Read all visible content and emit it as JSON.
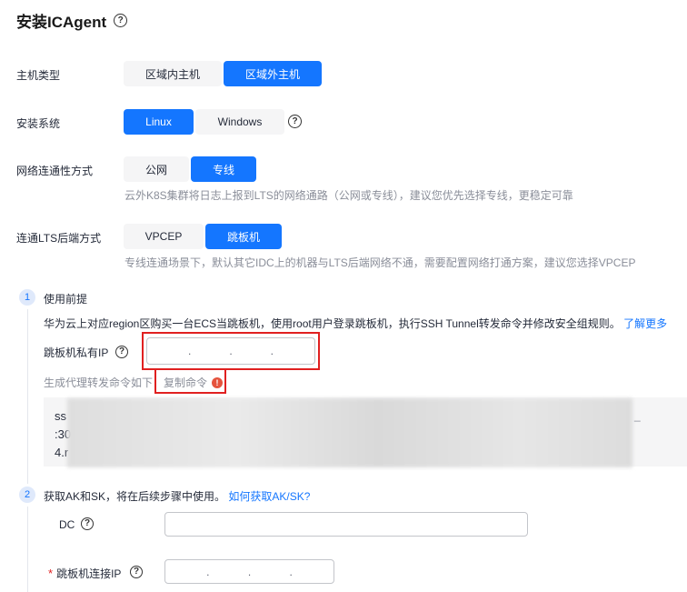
{
  "title": "安装ICAgent",
  "rows": {
    "host_type": {
      "label": "主机类型",
      "options": [
        "区域内主机",
        "区域外主机"
      ],
      "selected": 1
    },
    "os": {
      "label": "安装系统",
      "options": [
        "Linux",
        "Windows"
      ],
      "selected": 0
    },
    "network": {
      "label": "网络连通性方式",
      "options": [
        "公网",
        "专线"
      ],
      "selected": 1,
      "hint": "云外K8S集群将日志上报到LTS的网络通路（公网或专线），建议您优先选择专线，更稳定可靠"
    },
    "lts_backend": {
      "label": "连通LTS后端方式",
      "options": [
        "VPCEP",
        "跳板机"
      ],
      "selected": 1,
      "hint": "专线连通场景下，默认其它IDC上的机器与LTS后端网络不通，需要配置网络打通方案，建议您选择VPCEP"
    }
  },
  "step1": {
    "num": "1",
    "title": "使用前提",
    "desc": "华为云上对应region区购买一台ECS当跳板机，使用root用户登录跳板机，执行SSH Tunnel转发命令并修改安全组规则。",
    "learn_more": "了解更多",
    "ip_label": "跳板机私有IP",
    "ip_dots": [
      ".",
      ".",
      "."
    ],
    "gen_label": "生成代理转发命令如下",
    "copy_label": "复制命令",
    "code_lines": [
      "ss",
      ":30",
      "4.r"
    ],
    "code_tail": "_"
  },
  "step2": {
    "num": "2",
    "desc": "获取AK和SK，将在后续步骤中使用。",
    "link": "如何获取AK/SK?",
    "dc_label": "DC",
    "jump_ip_label": "跳板机连接IP",
    "required_mark": "*",
    "ip_dots": [
      ".",
      ".",
      "."
    ]
  },
  "colors": {
    "primary": "#1476ff",
    "highlight_border": "#e02020",
    "warning_icon": "#e5533d"
  }
}
